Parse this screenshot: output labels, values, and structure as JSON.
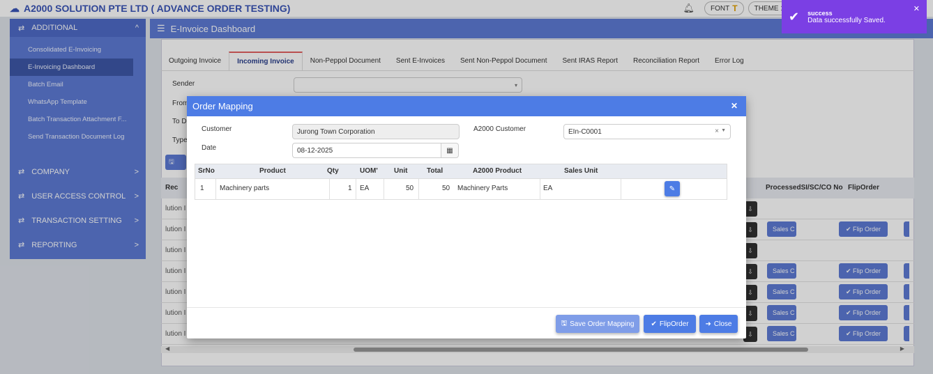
{
  "header": {
    "title": "A2000 SOLUTION PTE LTD ( ADVANCE ORDER TESTING)",
    "font_label": "FONT",
    "theme_label": "THEME 1"
  },
  "sidebar": {
    "section": "ADDITIONAL",
    "items": [
      "Consolidated E-Invoicing",
      "E-Invoicing Dashboard",
      "Batch Email",
      "WhatsApp Template",
      "Batch Transaction Attachment F...",
      "Send Transaction Document Log"
    ],
    "groups": [
      "COMPANY",
      "USER ACCESS CONTROL",
      "TRANSACTION SETTING",
      "REPORTING"
    ]
  },
  "page": {
    "title": "E-Invoice Dashboard"
  },
  "tabs": [
    "Outgoing Invoice",
    "Incoming Invoice",
    "Non-Peppol Document",
    "Sent E-Invoices",
    "Sent Non-Peppol Document",
    "Sent IRAS Report",
    "Reconciliation Report",
    "Error Log"
  ],
  "filters": {
    "sender": "Sender",
    "from": "From",
    "to": "To D",
    "type": "Type"
  },
  "background_table": {
    "headers": {
      "rec": "Rec",
      "processed": "ProcessedSI/SC/CO No",
      "flip": "FlipOrder"
    },
    "row_text": "lution I",
    "sales_label": "Sales C",
    "flip_label": "✔ Flip Order"
  },
  "modal": {
    "title": "Order Mapping",
    "customer_label": "Customer",
    "customer_value": "Jurong Town Corporation",
    "a2000_customer_label": "A2000 Customer",
    "a2000_customer_value": "EIn-C0001",
    "date_label": "Date",
    "date_value": "08-12-2025",
    "table": {
      "headers": [
        "SrNo",
        "Product",
        "Qty",
        "UOM'",
        "Unit",
        "Total",
        "A2000 Product",
        "Sales Unit"
      ],
      "rows": [
        {
          "srno": "1",
          "product": "Machinery parts",
          "qty": "1",
          "uom": "EA",
          "unit": "50",
          "total": "50",
          "a2000_product": "Machinery Parts",
          "sales_unit": "EA"
        }
      ]
    },
    "buttons": {
      "save": "Save Order Mapping",
      "flip": "FlipOrder",
      "close": "Close"
    }
  },
  "toast": {
    "title": "success",
    "message": "Data successfully Saved."
  },
  "colors": {
    "primary": "#4d7ce5",
    "sidebar": "#5d7bd5",
    "toast": "#7b3fe4"
  }
}
